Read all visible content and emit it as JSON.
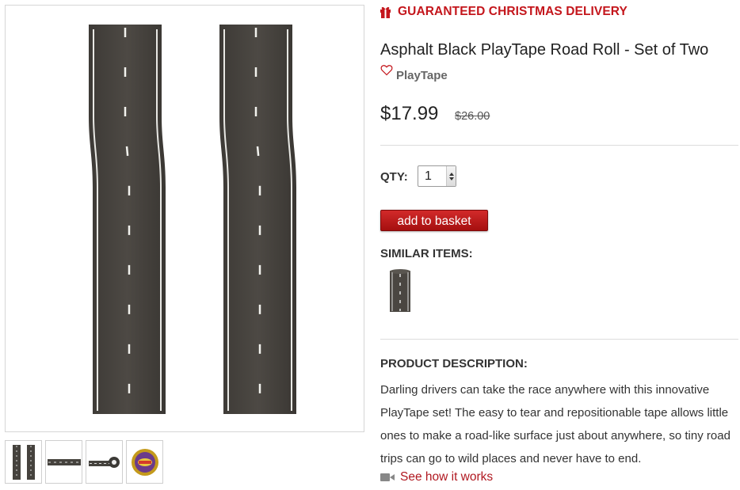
{
  "promo": {
    "icon": "gift-icon",
    "text": "GUARANTEED CHRISTMAS DELIVERY",
    "color": "#c4161c"
  },
  "product": {
    "title": "Asphalt Black PlayTape Road Roll - Set of Two",
    "brand": "PlayTape",
    "favorite_icon": "heart-outline-icon",
    "price": "$17.99",
    "original_price": "$26.00"
  },
  "images": {
    "main": "two-asphalt-road-tape-strips",
    "thumbnails": [
      "two-road-tape-strips",
      "horizontal-road-strip",
      "road-tape-roll-unrolled",
      "playtape-packaging-roll"
    ]
  },
  "purchase": {
    "qty_label": "QTY:",
    "qty_value": "1",
    "add_button": "add to basket",
    "button_color": "#b51616"
  },
  "similar": {
    "heading": "SIMILAR ITEMS:",
    "items": [
      "road-tape-strip"
    ]
  },
  "description": {
    "heading": "PRODUCT DESCRIPTION:",
    "text": "Darling drivers can take the race anywhere with this innovative PlayTape set! The easy to tear and repositionable tape allows little ones to make a road-like surface just about anywhere, so tiny road trips can go to wild places and never have to end.",
    "video_icon": "video-camera-icon",
    "video_link": "See how it works"
  }
}
